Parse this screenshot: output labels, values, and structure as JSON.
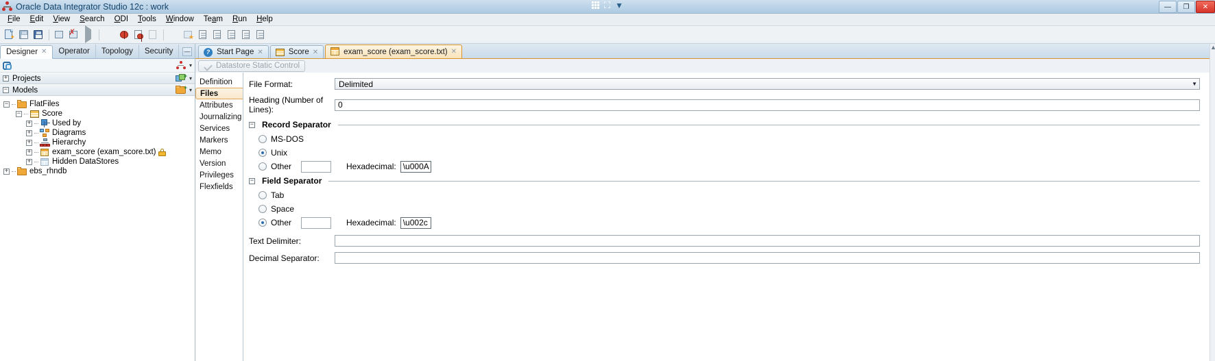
{
  "window": {
    "title": "Oracle Data Integrator Studio 12c : work",
    "app_icon": "odi-nodes-icon",
    "center_icons": [
      "grid-icon",
      "expand-icon",
      "chevron-down-icon"
    ],
    "buttons": {
      "minimize": "—",
      "restore": "❐",
      "close": "✕"
    }
  },
  "menubar": [
    {
      "label": "File",
      "mnemonic": "F"
    },
    {
      "label": "Edit",
      "mnemonic": "E"
    },
    {
      "label": "View",
      "mnemonic": "V"
    },
    {
      "label": "Search",
      "mnemonic": "S"
    },
    {
      "label": "ODI",
      "mnemonic": "O"
    },
    {
      "label": "Tools",
      "mnemonic": "T"
    },
    {
      "label": "Window",
      "mnemonic": "W"
    },
    {
      "label": "Team",
      "mnemonic": "a"
    },
    {
      "label": "Run",
      "mnemonic": "R"
    },
    {
      "label": "Help",
      "mnemonic": "H"
    }
  ],
  "toolbar": {
    "items": [
      "new-icon",
      "save-icon",
      "save-all-icon",
      "undo-icon",
      "redo-icon",
      "run-icon",
      "stop-icon",
      "debug-icon",
      "step-into-icon",
      "step-over-icon",
      "resume-icon",
      "favorites-icon",
      "doc1-icon",
      "doc2-icon",
      "doc3-icon",
      "doc4-icon",
      "doc5-icon"
    ]
  },
  "left_panel": {
    "dock_tabs": [
      {
        "label": "Designer",
        "closable": true,
        "active": true
      },
      {
        "label": "Operator",
        "closable": false,
        "active": false
      },
      {
        "label": "Topology",
        "closable": false,
        "active": false
      },
      {
        "label": "Security",
        "closable": false,
        "active": false
      }
    ],
    "minimize_label": "—",
    "panel_toolbar": {
      "refresh_icon": "refresh-icon",
      "tree_icon": "connect-navigator-icon",
      "caret": "▾"
    },
    "accordions": [
      {
        "label": "Projects",
        "expanded": false,
        "toggle": "+",
        "icon": "new-project-icon",
        "caret": "▾"
      },
      {
        "label": "Models",
        "expanded": true,
        "toggle": "−",
        "icon": "new-model-folder-icon",
        "caret": "▾"
      }
    ],
    "tree": [
      {
        "label": "FlatFiles",
        "depth": 0,
        "toggle": "−",
        "icon": "folder-icon",
        "lock": false
      },
      {
        "label": "Score",
        "depth": 1,
        "toggle": "−",
        "icon": "model-icon",
        "lock": false
      },
      {
        "label": "Used by",
        "depth": 2,
        "toggle": "+",
        "icon": "used-by-icon",
        "lock": false
      },
      {
        "label": "Diagrams",
        "depth": 2,
        "toggle": "+",
        "icon": "diagrams-icon",
        "lock": false
      },
      {
        "label": "Hierarchy",
        "depth": 2,
        "toggle": "+",
        "icon": "hierarchy-icon",
        "lock": false
      },
      {
        "label": "exam_score (exam_score.txt)",
        "depth": 2,
        "toggle": "+",
        "icon": "datastore-icon",
        "lock": true
      },
      {
        "label": "Hidden DataStores",
        "depth": 2,
        "toggle": "+",
        "icon": "hidden-datastores-icon",
        "lock": false
      },
      {
        "label": "ebs_rhndb",
        "depth": 0,
        "toggle": "+",
        "icon": "folder-icon",
        "lock": false
      }
    ]
  },
  "editor": {
    "tabs": [
      {
        "label": "Start Page",
        "icon": "help-icon",
        "closable": true,
        "active": false
      },
      {
        "label": "Score",
        "icon": "model-icon",
        "closable": true,
        "active": false
      },
      {
        "label": "exam_score (exam_score.txt)",
        "icon": "datastore-icon",
        "closable": true,
        "active": true
      }
    ],
    "static_control": {
      "label": "Datastore Static Control",
      "icon": "check-icon",
      "enabled": false
    },
    "side_tabs": [
      {
        "label": "Definition",
        "active": false
      },
      {
        "label": "Files",
        "active": true
      },
      {
        "label": "Attributes",
        "active": false
      },
      {
        "label": "Journalizing",
        "active": false
      },
      {
        "label": "Services",
        "active": false
      },
      {
        "label": "Markers",
        "active": false
      },
      {
        "label": "Memo",
        "active": false
      },
      {
        "label": "Version",
        "active": false
      },
      {
        "label": "Privileges",
        "active": false
      },
      {
        "label": "Flexfields",
        "active": false
      }
    ],
    "form": {
      "file_format": {
        "label": "File Format:",
        "value": "Delimited",
        "arrow": "▼"
      },
      "heading": {
        "label": "Heading (Number of Lines):",
        "value": "0"
      },
      "record_separator": {
        "title": "Record Separator",
        "toggle": "−",
        "options": [
          {
            "label": "MS-DOS",
            "selected": false
          },
          {
            "label": "Unix",
            "selected": true
          },
          {
            "label": "Other",
            "selected": false,
            "value": ""
          }
        ],
        "hex_label": "Hexadecimal:",
        "hex_value": "\\u000A"
      },
      "field_separator": {
        "title": "Field Separator",
        "toggle": "−",
        "options": [
          {
            "label": "Tab",
            "selected": false
          },
          {
            "label": "Space",
            "selected": false
          },
          {
            "label": "Other",
            "selected": true,
            "value": ""
          }
        ],
        "hex_label": "Hexadecimal:",
        "hex_value": "\\u002c"
      },
      "text_delimiter": {
        "label": "Text Delimiter:",
        "value": ""
      },
      "decimal_separator": {
        "label": "Decimal Separator:",
        "value": ""
      }
    }
  },
  "colors": {
    "titlebar": "#bcd4e8",
    "active_tab": "#f8e3bb",
    "accent_orange": "#d8932b",
    "selected_radio": "#2b6cb0"
  }
}
